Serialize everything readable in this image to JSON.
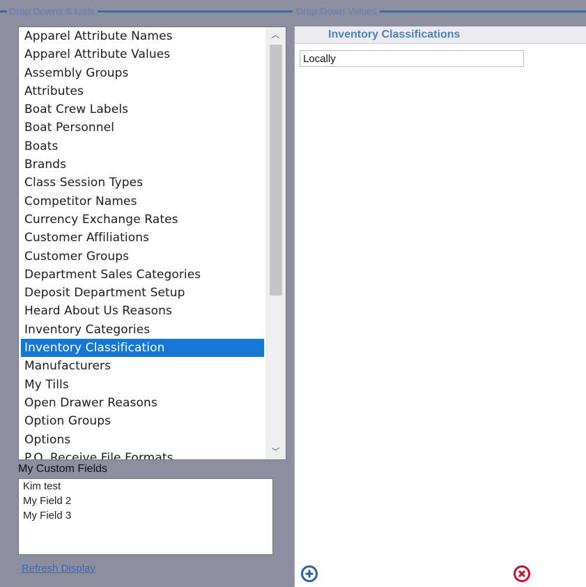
{
  "left_group": {
    "title": "Drop Downs & Lists"
  },
  "right_group": {
    "title": "Drop Down Values"
  },
  "lists": {
    "items": [
      "Apparel Attribute Names",
      "Apparel Attribute Values",
      "Assembly Groups",
      "Attributes",
      "Boat Crew Labels",
      "Boat Personnel",
      "Boats",
      "Brands",
      "Class Session Types",
      "Competitor Names",
      "Currency Exchange Rates",
      "Customer Affiliations",
      "Customer Groups",
      "Department Sales Categories",
      "Deposit Department Setup",
      "Heard About Us Reasons",
      "Inventory Categories",
      "Inventory Classification",
      "Manufacturers",
      "My Tills",
      "Open Drawer Reasons",
      "Option Groups",
      "Options",
      "P.O. Receive File Formats"
    ],
    "selected": "Inventory Classification"
  },
  "custom_fields": {
    "label": "My Custom Fields",
    "items": [
      "Kim test",
      "My Field 2",
      "My Field 3"
    ]
  },
  "refresh_link": "Refresh Display",
  "values_panel": {
    "header": "Inventory Classifications",
    "values": [
      "Locally"
    ]
  },
  "colors": {
    "selection": "#1677d6",
    "accent": "#2a6fc0",
    "add_icon": "#2a5fa8",
    "delete_icon": "#c8102e"
  },
  "icons": {
    "add": "plus-circle-icon",
    "delete": "x-circle-icon"
  }
}
